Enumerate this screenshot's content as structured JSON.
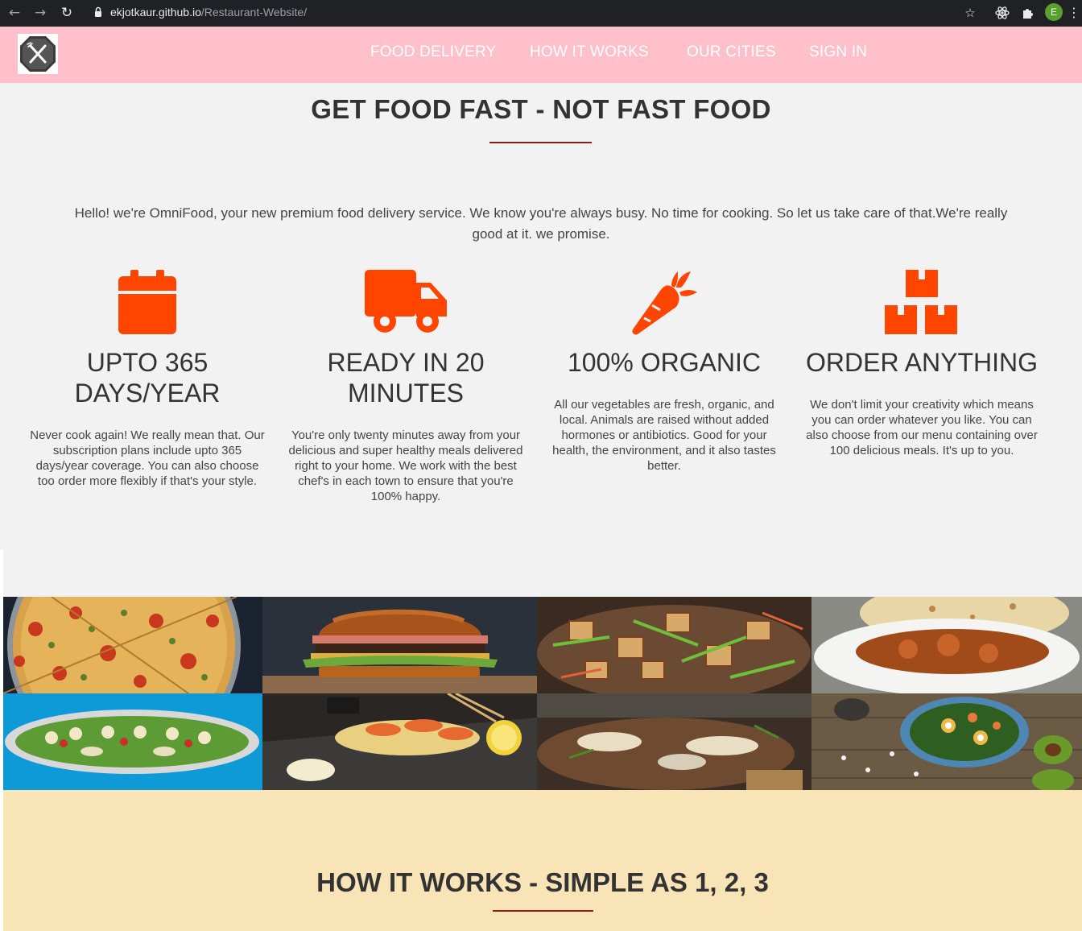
{
  "browser": {
    "url_host": "ekjotkaur.github.io",
    "url_path": "/Restaurant-Website/",
    "profile_initial": "E",
    "icons": [
      "back-icon",
      "forward-icon",
      "reload-icon",
      "lock-icon",
      "star-icon",
      "react-devtools-icon",
      "extensions-icon",
      "menu-icon"
    ]
  },
  "header": {
    "logo_icon": "fork-knife-icon",
    "nav": [
      {
        "label": "FOOD DELIVERY"
      },
      {
        "label": "HOW IT WORKS"
      },
      {
        "label": "OUR CITIES"
      },
      {
        "label": "SIGN IN"
      }
    ]
  },
  "main": {
    "title": "GET FOOD FAST - NOT FAST FOOD",
    "intro": "Hello! we're OmniFood, your new premium food delivery service. We know you're always busy. No time for cooking. So let us take care of that.We're really good at it. we promise.",
    "features": [
      {
        "icon": "calendar-icon",
        "title": "UPTO 365 DAYS/YEAR",
        "text": "Never cook again! We really mean that. Our subscription plans include upto 365 days/year coverage. You can also choose too order more flexibly if that's your style."
      },
      {
        "icon": "truck-icon",
        "title": "READY IN 20 MINUTES",
        "text": "You're only twenty minutes away from your delicious and super healthy meals delivered right to your home. We work with the best chef's in each town to ensure that you're 100% happy."
      },
      {
        "icon": "carrot-icon",
        "title": "100% ORGANIC",
        "text": "All our vegetables are fresh, organic, and local. Animals are raised without added hormones or antibiotics. Good for your health, the environment, and it also tastes better."
      },
      {
        "icon": "boxes-icon",
        "title": "ORDER ANYTHING",
        "text": "We don't limit your creativity which means you can order whatever you like. You can also choose from our menu containing over 100 delicious meals. It's up to you."
      }
    ]
  },
  "gallery": {
    "images": [
      "pizza-image",
      "burger-image",
      "tofu-stirfry-image",
      "curry-naan-image",
      "salad-platter-image",
      "shrimp-dish-image",
      "grilled-fish-image",
      "veggie-bowl-image"
    ]
  },
  "how_it_works": {
    "title": "HOW IT WORKS - SIMPLE AS 1, 2, 3"
  },
  "colors": {
    "nav_bg": "#ffc0cb",
    "accent_orange": "#ff4500",
    "rule": "#8b1a1a",
    "how_bg": "#f9e4b7",
    "page_bg": "#f2f2f2"
  }
}
